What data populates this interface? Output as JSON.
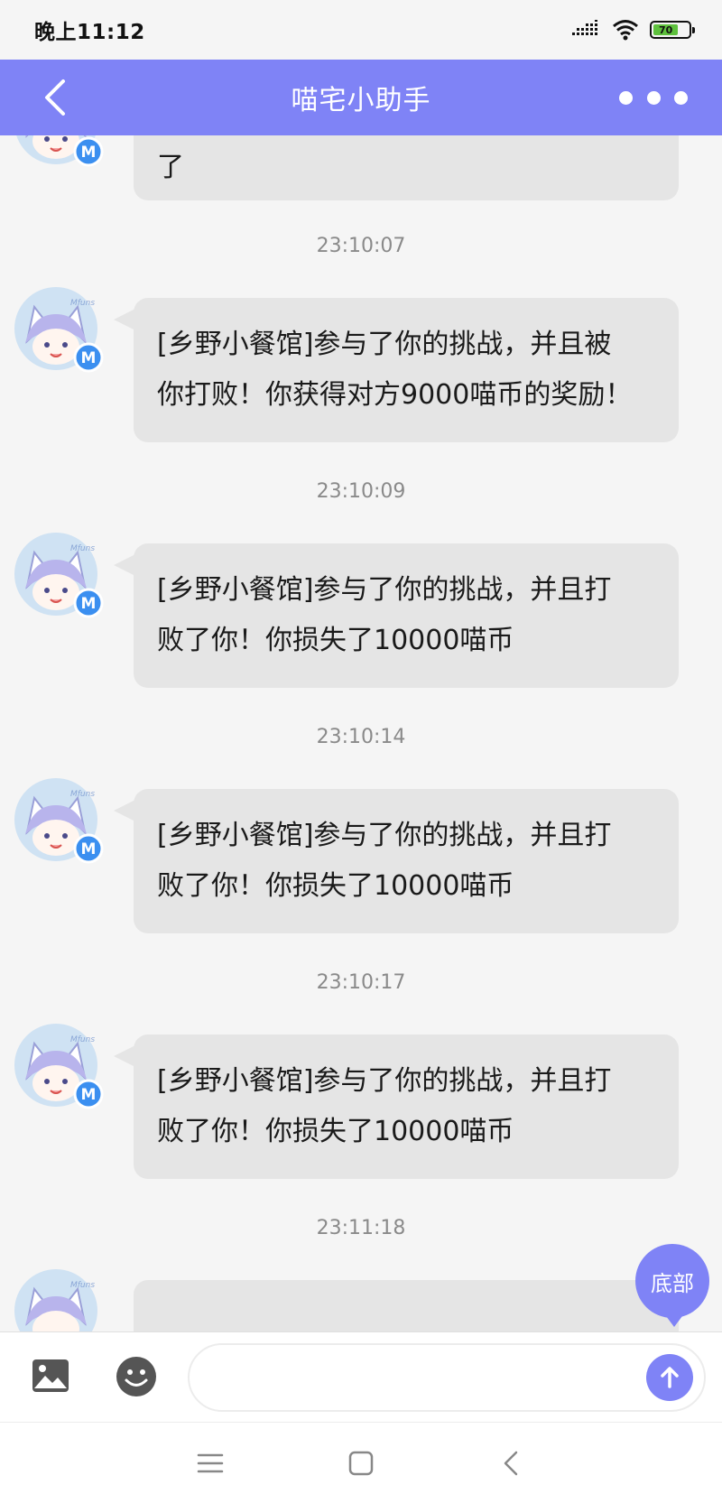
{
  "status_bar": {
    "time": "晚上11:12",
    "battery": "70"
  },
  "header": {
    "title": "喵宅小助手"
  },
  "float_button": {
    "label": "底部"
  },
  "messages": [
    {
      "timestamp": "",
      "lines": [
        "了"
      ]
    },
    {
      "timestamp": "23:10:07",
      "lines": [
        "[乡野小餐馆]参与了你的挑战，并且被",
        "你打败！你获得对方9000喵币的奖励！"
      ]
    },
    {
      "timestamp": "23:10:09",
      "lines": [
        "[乡野小餐馆]参与了你的挑战，并且打",
        "败了你！你损失了10000喵币"
      ]
    },
    {
      "timestamp": "23:10:14",
      "lines": [
        "[乡野小餐馆]参与了你的挑战，并且打",
        "败了你！你损失了10000喵币"
      ]
    },
    {
      "timestamp": "23:10:17",
      "lines": [
        "[乡野小餐馆]参与了你的挑战，并且打",
        "败了你！你损失了10000喵币"
      ]
    },
    {
      "timestamp": "23:11:18",
      "lines": [
        ""
      ]
    }
  ],
  "input": {
    "value": "",
    "placeholder": ""
  },
  "colors": {
    "accent": "#7f83f6",
    "bubble": "#e5e5e5",
    "badge": "#3b8ff0"
  }
}
